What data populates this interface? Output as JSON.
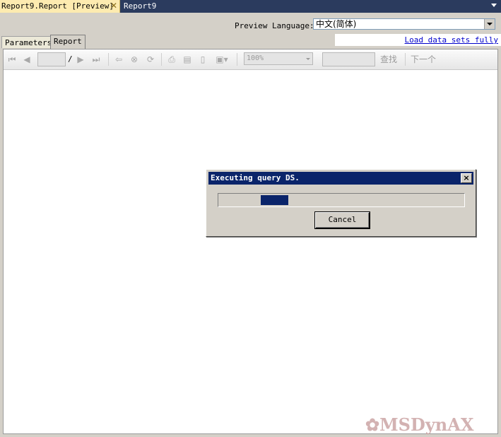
{
  "tabs": [
    {
      "label": "Report9.Report [Preview]",
      "active": true
    },
    {
      "label": "Report9",
      "active": false
    }
  ],
  "preview_language": {
    "label": "Preview Language:",
    "value": "中文(简体)"
  },
  "load_link": "Load data sets fully",
  "subtabs": [
    "Parameters",
    "Report"
  ],
  "toolbar": {
    "page_separator": "/",
    "zoom": "100%",
    "find_label": "查找",
    "next_label": "下一个"
  },
  "icons": [
    "first-page-icon",
    "prev-page-icon",
    "next-page-icon",
    "last-page-icon",
    "back-icon",
    "stop-icon",
    "refresh-icon",
    "print-icon",
    "print-layout-icon",
    "page-setup-icon",
    "export-icon"
  ],
  "dialog": {
    "title": "Executing query DS.",
    "progress": 0.11,
    "cancel_label": "Cancel"
  },
  "watermark": "MSDynAX",
  "colors": {
    "active_tab": "#fdebb0",
    "tabstrip": "#2b3b5e",
    "dialog_title": "#0a246a",
    "link": "#0000cc"
  }
}
